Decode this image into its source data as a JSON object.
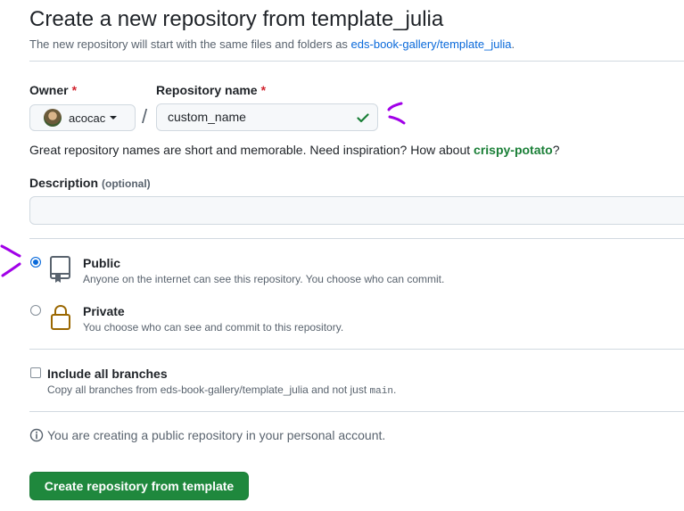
{
  "header": {
    "title": "Create a new repository from template_julia",
    "subtitle_prefix": "The new repository will start with the same files and folders as ",
    "template_link": "eds-book-gallery/template_julia",
    "subtitle_suffix": "."
  },
  "owner": {
    "label": "Owner",
    "required_mark": "*",
    "value": "acocac",
    "separator": "/"
  },
  "repository_name": {
    "label": "Repository name",
    "required_mark": "*",
    "value": "custom_name",
    "valid": true
  },
  "name_hint": {
    "prefix": "Great repository names are short and memorable. Need inspiration? How about ",
    "suggestion": "crispy-potato",
    "suffix": "?"
  },
  "description": {
    "label": "Description",
    "optional_text": "(optional)",
    "value": ""
  },
  "visibility": {
    "selected": "public",
    "options": [
      {
        "id": "public",
        "title": "Public",
        "description": "Anyone on the internet can see this repository. You choose who can commit.",
        "icon": "repo-icon"
      },
      {
        "id": "private",
        "title": "Private",
        "description": "You choose who can see and commit to this repository.",
        "icon": "lock-icon"
      }
    ]
  },
  "include_branches": {
    "label": "Include all branches",
    "checked": false,
    "description_prefix": "Copy all branches from eds-book-gallery/template_julia and not just ",
    "description_code": "main",
    "description_suffix": "."
  },
  "info_message": "You are creating a public repository in your personal account.",
  "submit_button": "Create repository from template",
  "colors": {
    "accent": "#0969da",
    "success": "#1f883d",
    "annotation": "#a100e8"
  }
}
